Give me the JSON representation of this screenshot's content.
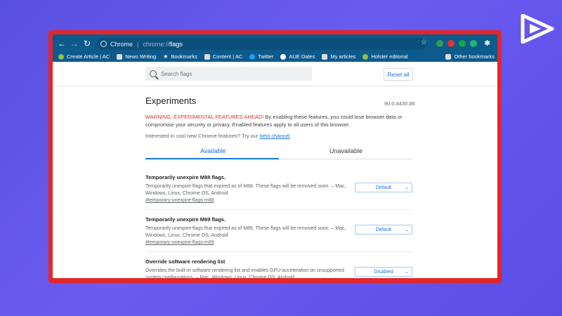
{
  "browser": {
    "omnibox": {
      "site_name": "Chrome",
      "url_scheme": "chrome://",
      "url_path": "flags"
    },
    "bookmarks": [
      {
        "label": "Create Article | AC",
        "icon": "android-icon",
        "color": "#8bc34a"
      },
      {
        "label": "News Writing",
        "icon": "folder-icon",
        "color": "#dcdcdc"
      },
      {
        "label": "Bookmarks",
        "icon": "star-icon",
        "color": "#ffffff"
      },
      {
        "label": "Content | AC",
        "icon": "folder-icon",
        "color": "#dcdcdc"
      },
      {
        "label": "Twitter",
        "icon": "twitter-icon",
        "color": "#1da1f2"
      },
      {
        "label": "AUE Dates",
        "icon": "chrome-icon",
        "color": "#ffffff"
      },
      {
        "label": "My articles",
        "icon": "folder-icon",
        "color": "#dcdcdc"
      },
      {
        "label": "Holster editorial",
        "icon": "android-icon",
        "color": "#8bc34a"
      }
    ],
    "other_bookmarks": "Other bookmarks"
  },
  "search": {
    "placeholder": "Search flags"
  },
  "reset_label": "Reset all",
  "page": {
    "title": "Experiments",
    "version": "90.0.4430.86",
    "warning_red": "WARNING: EXPERIMENTAL FEATURES AHEAD!",
    "warning_rest": " By enabling these features, you could lose browser data or compromise your security or privacy. Enabled features apply to all users of this browser.",
    "interest_text": "Interested in cool new Chrome features? Try our ",
    "beta_link": "beta channel",
    "interest_end": "."
  },
  "tabs": {
    "available": "Available",
    "unavailable": "Unavailable"
  },
  "flags": [
    {
      "title": "Temporarily unexpire M88 flags.",
      "desc": "Temporarily unexpire flags that expired as of M88. These flags will be removed soon. – Mac, Windows, Linux, Chrome OS, Android",
      "link": "#temporary-unexpire-flags-m88",
      "value": "Default"
    },
    {
      "title": "Temporarily unexpire M89 flags.",
      "desc": "Temporarily unexpire flags that expired as of M89. These flags will be removed soon. – Mac, Windows, Linux, Chrome OS, Android",
      "link": "#temporary-unexpire-flags-m89",
      "value": "Default"
    },
    {
      "title": "Override software rendering list",
      "desc": "Overrides the built-in software rendering list and enables GPU-acceleration on unsupported system configurations. – Mac, Windows, Linux, Chrome OS, Android",
      "link": "",
      "value": "Disabled"
    }
  ],
  "colors": {
    "background": "#5a4fe0",
    "frame": "#e3262b",
    "toolbar": "#0d5a8c",
    "accent": "#1a73e8"
  }
}
